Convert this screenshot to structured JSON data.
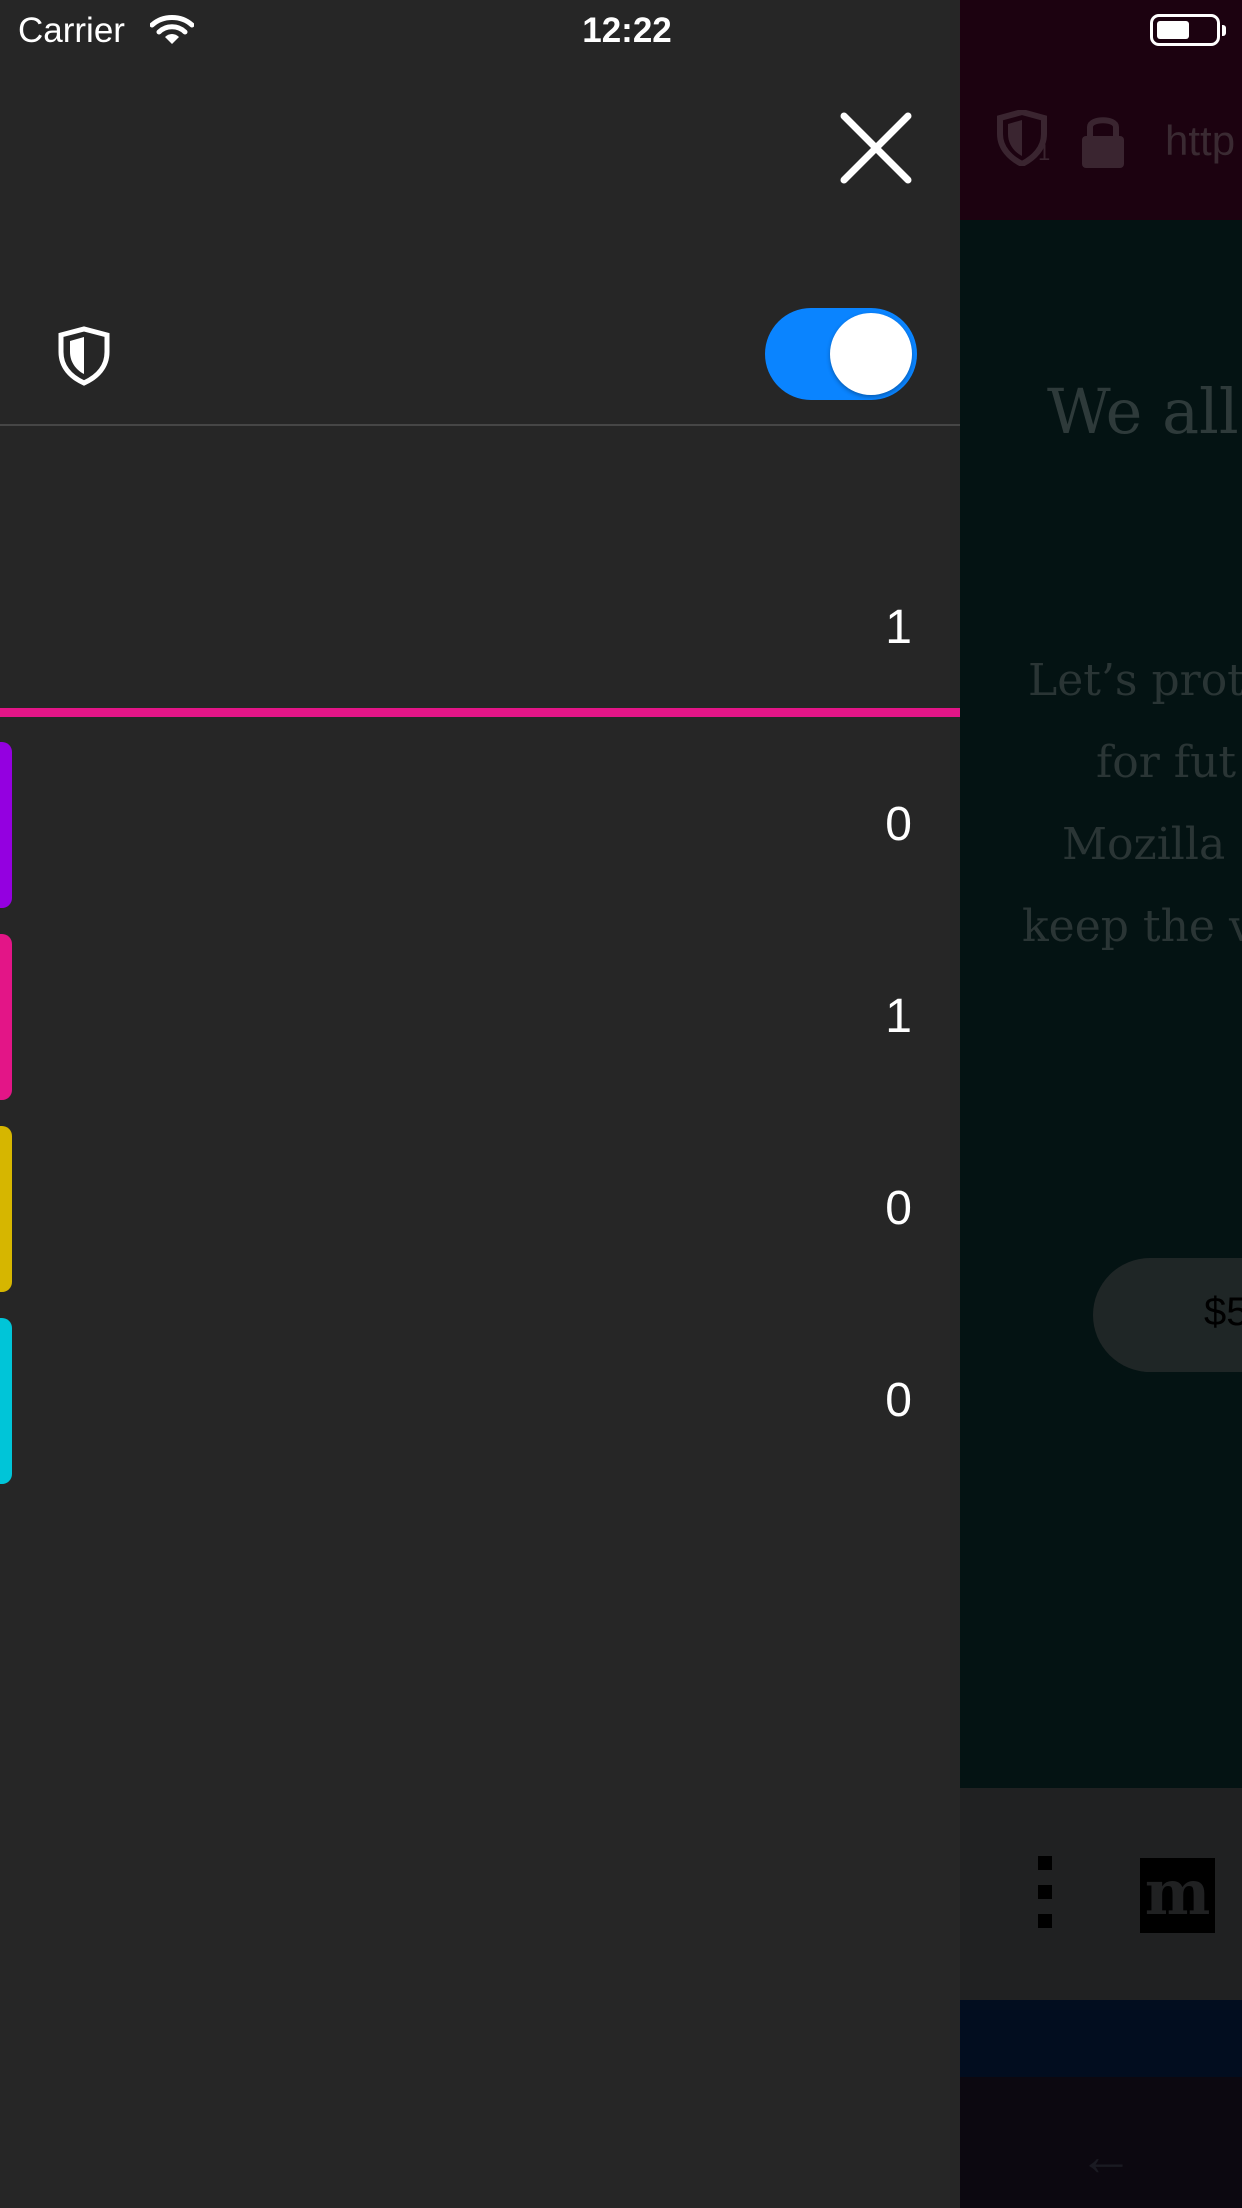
{
  "status_bar": {
    "carrier": "Carrier",
    "time": "12:22",
    "wifi_icon": "wifi-icon",
    "battery_icon": "battery-icon",
    "battery_level": 0.55
  },
  "panel": {
    "close_icon": "close-icon",
    "tracking_protection": {
      "icon": "shield-icon",
      "label": "",
      "enabled": true
    },
    "total": {
      "label": "",
      "count": "1",
      "bar_color": "#e31587"
    },
    "categories": [
      {
        "label": "",
        "count": "0",
        "color": "#9400e0"
      },
      {
        "label": "",
        "count": "1",
        "color": "#e31587"
      },
      {
        "label": "",
        "count": "0",
        "color": "#d6b600"
      },
      {
        "label": "",
        "count": "0",
        "color": "#00c5d8"
      }
    ]
  },
  "background_page": {
    "url_fragment": "http",
    "tracker_badge": "1",
    "headline_fragment": "We all",
    "paragraph_lines": [
      "Let’s prot",
      "for fut",
      "Mozilla",
      "keep the v"
    ],
    "donate_button_fragment": "$5",
    "menu_logo": "m"
  }
}
